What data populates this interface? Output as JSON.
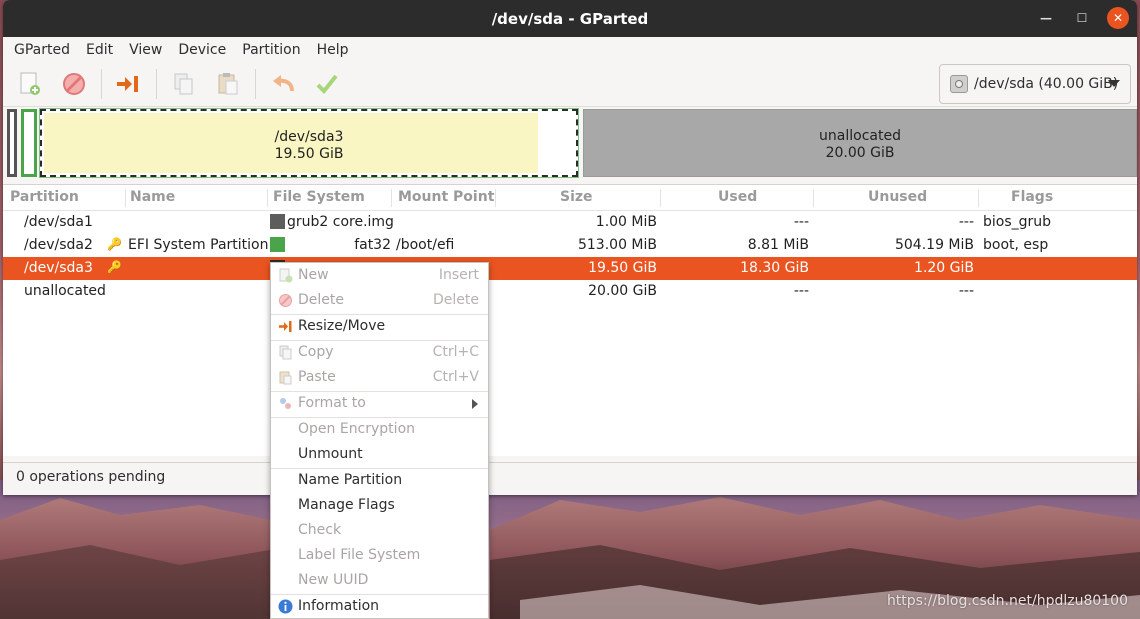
{
  "window": {
    "title": "/dev/sda - GParted",
    "controls": {
      "minimize": "—",
      "maximize": "☐",
      "close": "✕"
    }
  },
  "menubar": {
    "items": [
      "GParted",
      "Edit",
      "View",
      "Device",
      "Partition",
      "Help"
    ]
  },
  "toolbar": {
    "buttons": [
      "new-icon",
      "delete-icon",
      "resize-move-icon",
      "copy-icon",
      "paste-icon",
      "undo-icon",
      "apply-icon"
    ],
    "device": "/dev/sda (40.00 GiB)"
  },
  "diskmap": {
    "sda3": {
      "name": "/dev/sda3",
      "size": "19.50 GiB"
    },
    "unallocated": {
      "name": "unallocated",
      "size": "20.00 GiB"
    }
  },
  "table": {
    "headers": [
      "Partition",
      "Name",
      "File System",
      "Mount Point",
      "Size",
      "Used",
      "Unused",
      "Flags"
    ],
    "rows": [
      {
        "partition": "/dev/sda1",
        "name": "",
        "fs": "grub2 core.img",
        "fs_color": "#5d5d5d",
        "mount": "",
        "size": "1.00 MiB",
        "used": "---",
        "unused": "---",
        "flags": "bios_grub",
        "key": false
      },
      {
        "partition": "/dev/sda2",
        "name": "EFI System Partition",
        "fs": "fat32",
        "fs_color": "#4aa54a",
        "mount": "/boot/efi",
        "size": "513.00 MiB",
        "used": "8.81 MiB",
        "unused": "504.19 MiB",
        "flags": "boot, esp",
        "key": true
      },
      {
        "partition": "/dev/sda3",
        "name": "",
        "fs": "",
        "fs_color": "#2b2b2b",
        "mount": "",
        "size": "19.50 GiB",
        "used": "18.30 GiB",
        "unused": "1.20 GiB",
        "flags": "",
        "key": true
      },
      {
        "partition": "unallocated",
        "name": "",
        "fs": "",
        "fs_color": "",
        "mount": "",
        "size": "20.00 GiB",
        "used": "---",
        "unused": "---",
        "flags": "",
        "key": false
      }
    ]
  },
  "statusbar": {
    "text": "0 operations pending"
  },
  "context_menu": {
    "items": [
      {
        "label": "New",
        "accel": "Insert",
        "disabled": true
      },
      {
        "label": "Delete",
        "accel": "Delete",
        "disabled": true
      },
      {
        "label": "Resize/Move",
        "accel": "",
        "disabled": false
      },
      {
        "label": "Copy",
        "accel": "Ctrl+C",
        "disabled": true
      },
      {
        "label": "Paste",
        "accel": "Ctrl+V",
        "disabled": true
      },
      {
        "label": "Format to",
        "accel": "",
        "disabled": true
      },
      {
        "label": "Open Encryption",
        "accel": "",
        "disabled": true
      },
      {
        "label": "Unmount",
        "accel": "",
        "disabled": false
      },
      {
        "label": "Name Partition",
        "accel": "",
        "disabled": false
      },
      {
        "label": "Manage Flags",
        "accel": "",
        "disabled": false
      },
      {
        "label": "Check",
        "accel": "",
        "disabled": true
      },
      {
        "label": "Label File System",
        "accel": "",
        "disabled": true
      },
      {
        "label": "New UUID",
        "accel": "",
        "disabled": true
      },
      {
        "label": "Information",
        "accel": "",
        "disabled": false
      }
    ]
  },
  "watermark": "https://blog.csdn.net/hpdlzu80100",
  "colors": {
    "accent": "#e95420",
    "titlebar": "#2c2c2c",
    "sda3_fill": "#f9f6c4",
    "unallocated": "#a8a8a8"
  }
}
